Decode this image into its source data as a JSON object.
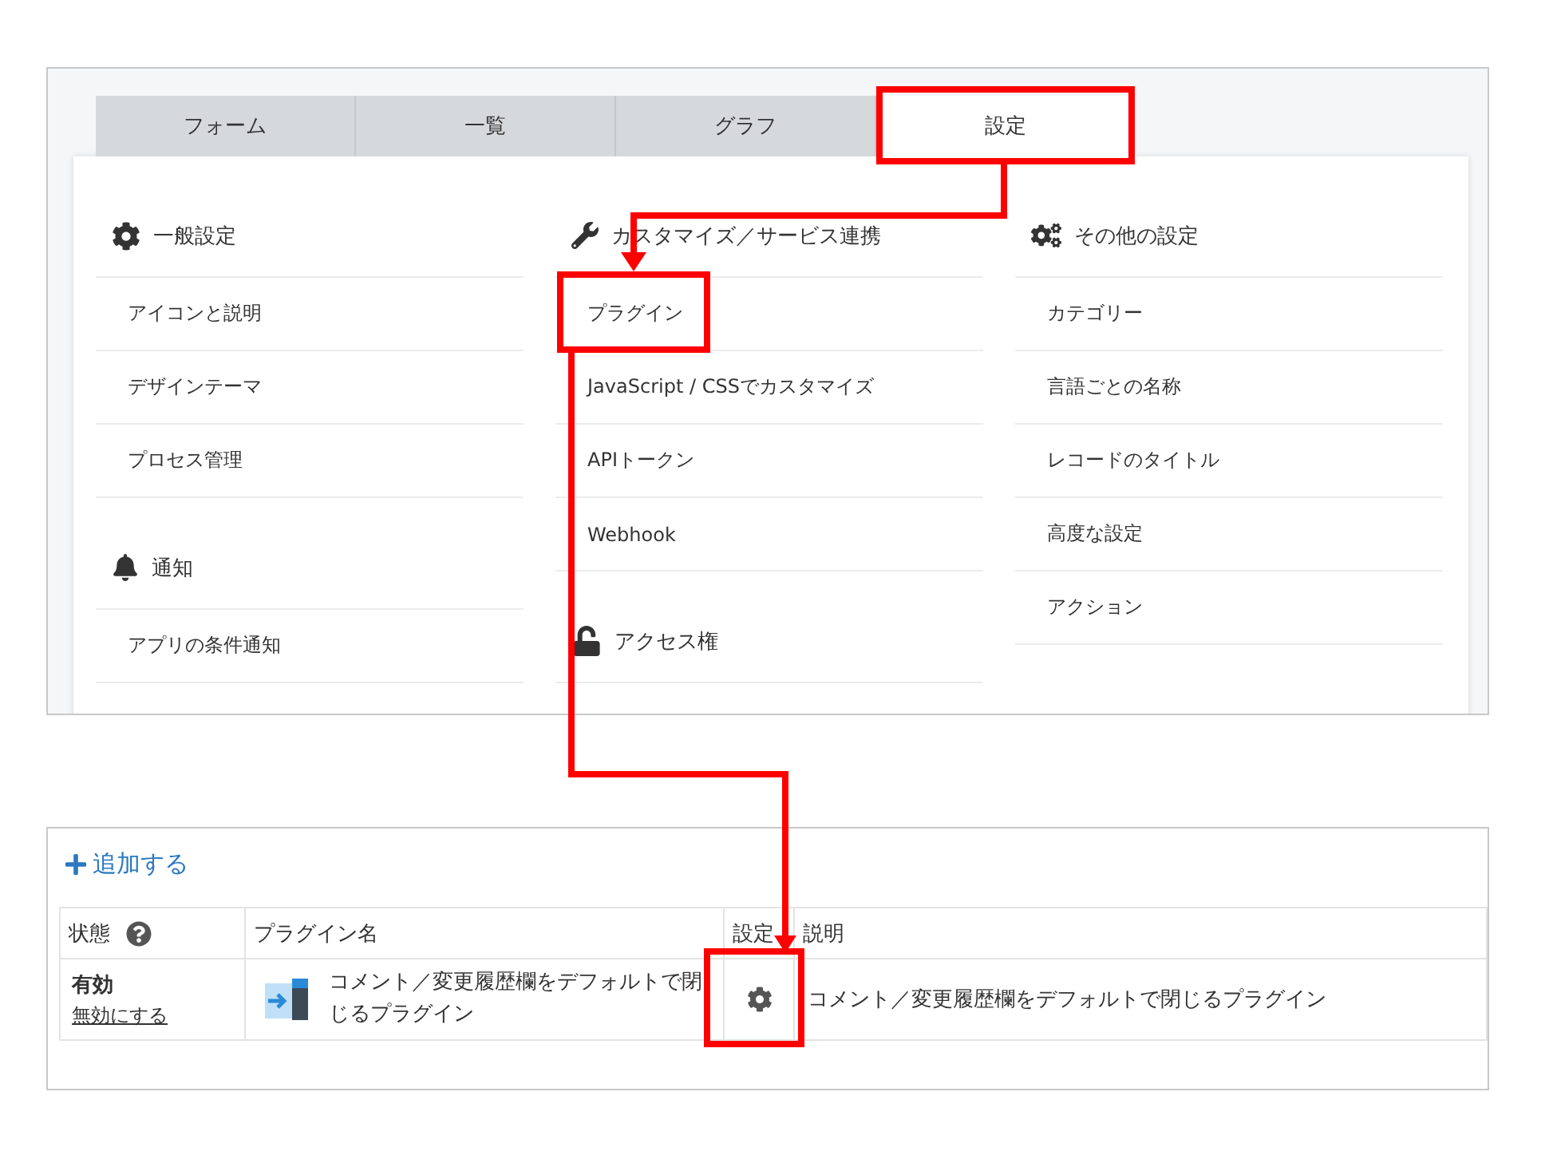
{
  "tabs": [
    {
      "label": "フォーム",
      "selected": false
    },
    {
      "label": "一覧",
      "selected": false
    },
    {
      "label": "グラフ",
      "selected": false
    },
    {
      "label": "設定",
      "selected": true
    }
  ],
  "settings_columns": [
    [
      {
        "title": "一般設定",
        "items": [
          "アイコンと説明",
          "デザインテーマ",
          "プロセス管理"
        ]
      },
      {
        "title": "通知",
        "items": [
          "アプリの条件通知"
        ]
      }
    ],
    [
      {
        "title": "カスタマイズ／サービス連携",
        "items": [
          "プラグイン",
          "JavaScript / CSSでカスタマイズ",
          "APIトークン",
          "Webhook"
        ]
      },
      {
        "title": "アクセス権"
      }
    ],
    [
      {
        "title": "その他の設定",
        "items": [
          "カテゴリー",
          "言語ごとの名称",
          "レコードのタイトル",
          "高度な設定",
          "アクション"
        ]
      }
    ]
  ],
  "plugin_list": {
    "add_button": "追加する",
    "columns": [
      "状態",
      "プラグイン名",
      "設定",
      "説明"
    ],
    "rows": [
      {
        "status": "有効",
        "toggle_link": "無効にする",
        "name": "コメント／変更履歴欄をデフォルトで閉じるプラグイン",
        "description": "コメント／変更履歴欄をデフォルトで閉じるプラグイン"
      }
    ]
  }
}
